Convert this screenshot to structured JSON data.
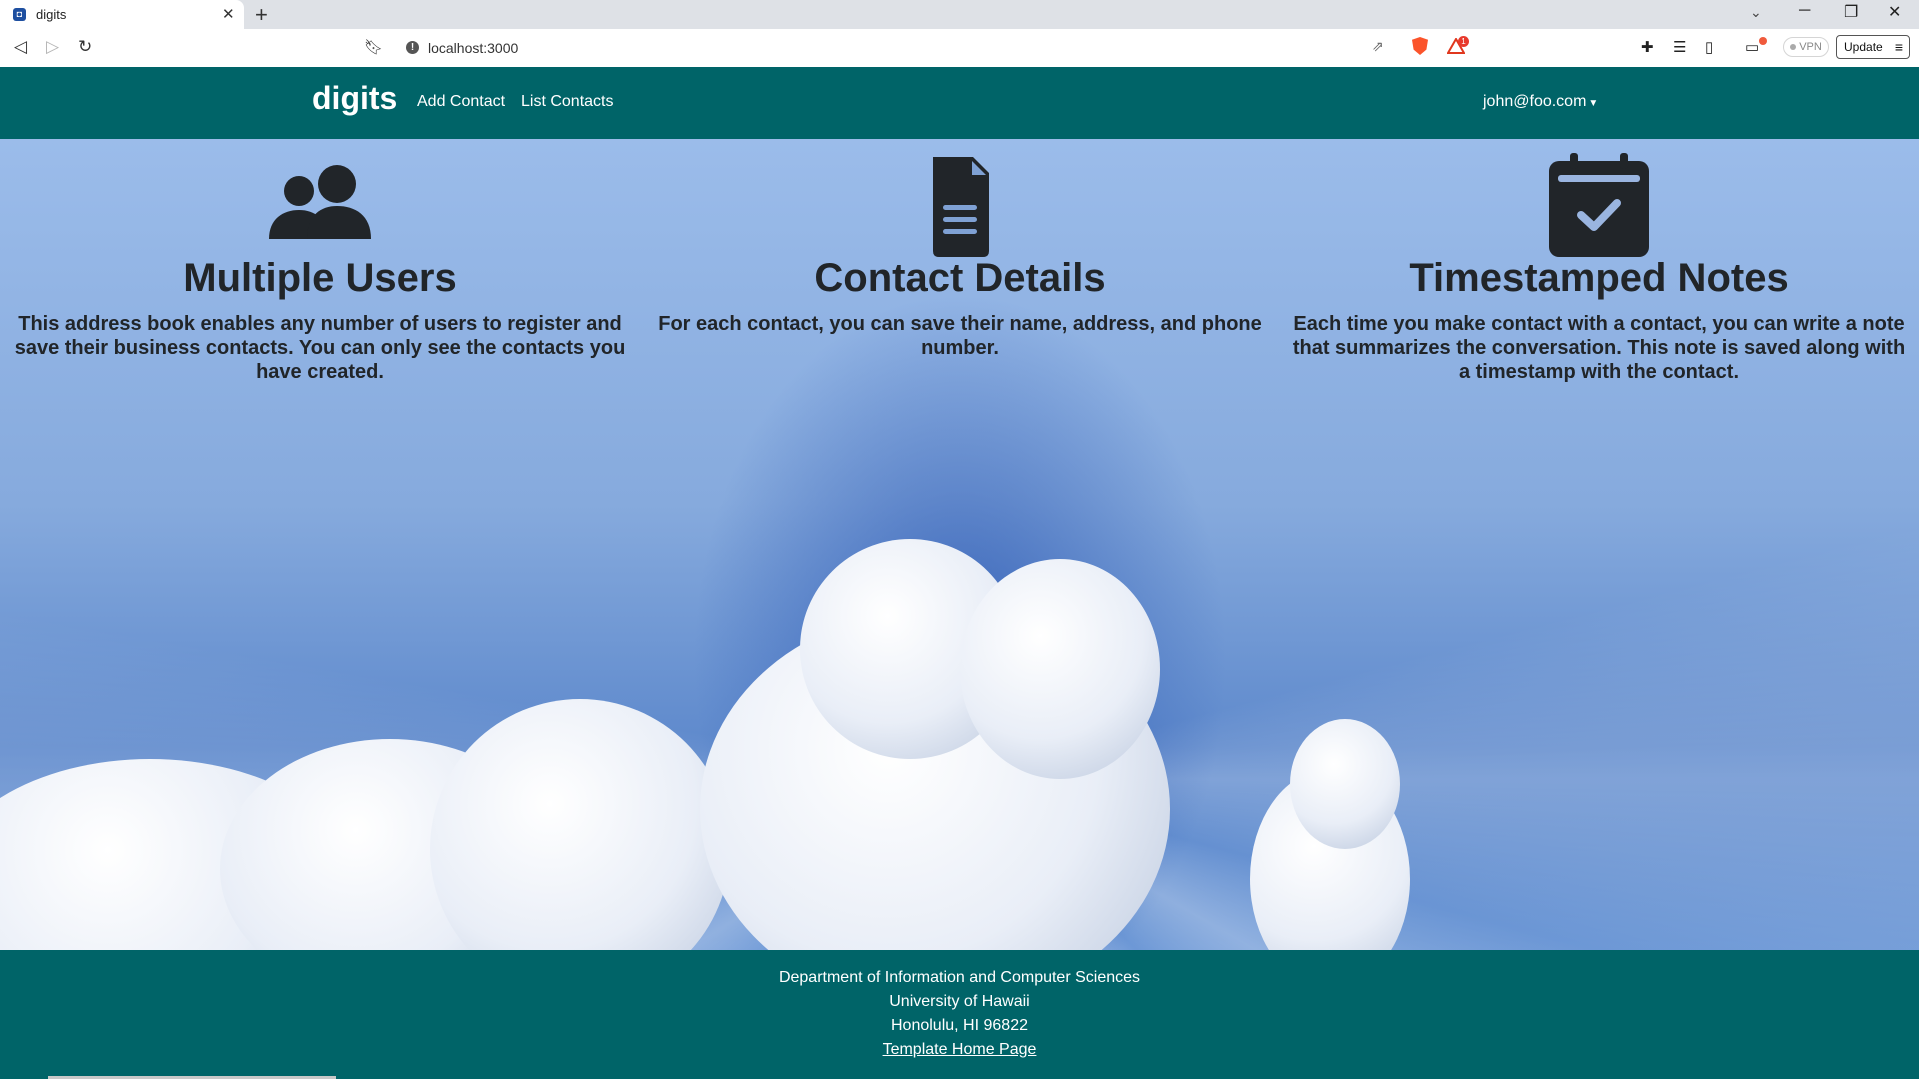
{
  "browser": {
    "tab_title": "digits",
    "url": "localhost:3000",
    "rewards_badge": "1",
    "vpn_label": "VPN",
    "update_label": "Update"
  },
  "navbar": {
    "brand": "digits",
    "links": [
      "Add Contact",
      "List Contacts"
    ],
    "user": "john@foo.com",
    "bg_color": "#006468"
  },
  "features": [
    {
      "icon": "users-icon",
      "title": "Multiple Users",
      "text": "This address book enables any number of users to register and save their business contacts. You can only see the contacts you have created."
    },
    {
      "icon": "file-lines-icon",
      "title": "Contact Details",
      "text": "For each contact, you can save their name, address, and phone number."
    },
    {
      "icon": "calendar-check-icon",
      "title": "Timestamped Notes",
      "text": "Each time you make contact with a contact, you can write a note that summarizes the conversation. This note is saved along with a timestamp with the contact."
    }
  ],
  "footer": {
    "lines": [
      "Department of Information and Computer Sciences",
      "University of Hawaii",
      "Honolulu, HI 96822"
    ],
    "link": "Template Home Page"
  }
}
